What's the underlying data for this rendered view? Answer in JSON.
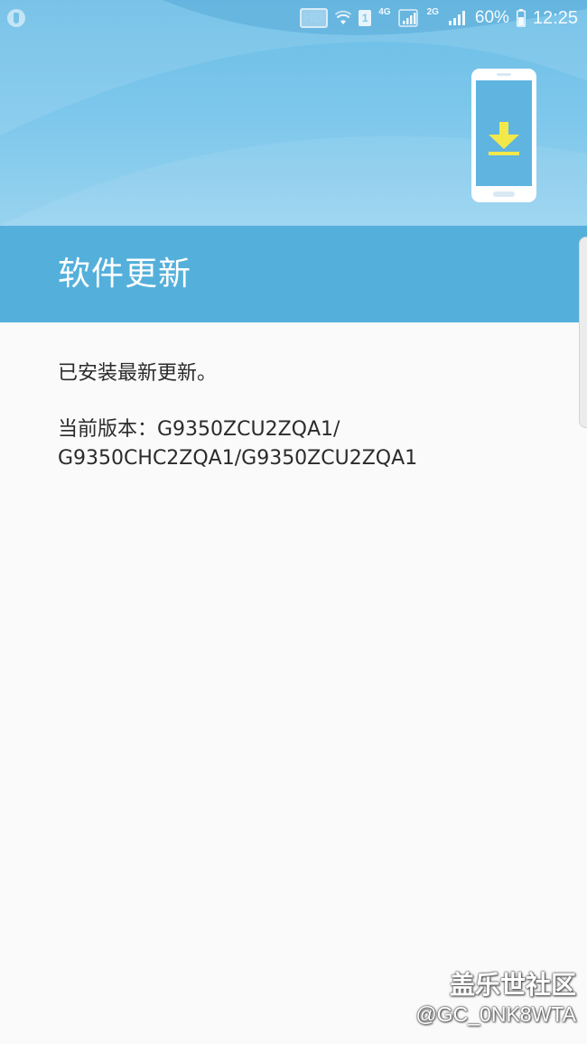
{
  "status_bar": {
    "hd": "HD",
    "sim_slot": "1",
    "network_4g": "4G",
    "network_2g": "2G",
    "battery": "60%",
    "time": "12:25",
    "left_icon": "sync-icon",
    "icons": [
      "wifi-icon",
      "signal-icon",
      "battery-icon"
    ]
  },
  "header": {
    "title": "软件更新",
    "illustration": "phone-download-icon",
    "accent_color": "#ffeb3b"
  },
  "main": {
    "status_message": "已安装最新更新。",
    "version_line1": "当前版本：G9350ZCU2ZQA1/",
    "version_line2": "G9350CHC2ZQA1/G9350ZCU2ZQA1"
  },
  "watermark": {
    "brand": "盖乐世社区",
    "user": "@GC_0NK8WTA"
  },
  "colors": {
    "title_bar": "#54b0db",
    "hero_gradient_top": "#6bbde6",
    "background": "#fafafa"
  }
}
